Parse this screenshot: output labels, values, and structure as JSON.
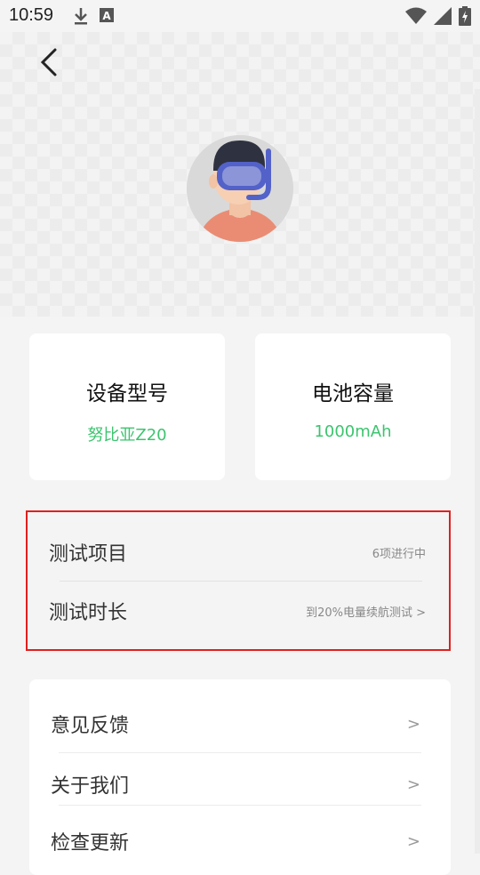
{
  "status_bar": {
    "time": "10:59",
    "icons_left": [
      "download-icon",
      "app-a-icon"
    ],
    "icons_right": [
      "wifi-icon",
      "signal-icon",
      "battery-charging-icon"
    ]
  },
  "header": {
    "back_icon": "chevron-left-icon",
    "avatar": "diver-avatar"
  },
  "cards": [
    {
      "title": "设备型号",
      "value": "努比亚Z20"
    },
    {
      "title": "电池容量",
      "value": "1000mAh"
    }
  ],
  "test_panel": {
    "rows": [
      {
        "label": "测试项目",
        "value": "6项进行中"
      },
      {
        "label": "测试时长",
        "value": "到20%电量续航测试 >"
      }
    ],
    "border_color": "#e0201e"
  },
  "menu": {
    "items": [
      {
        "label": "意见反馈",
        "arrow": ">"
      },
      {
        "label": "关于我们",
        "arrow": ">"
      },
      {
        "label": "检查更新",
        "arrow": ">"
      }
    ]
  },
  "colors": {
    "accent_green": "#3cc46e",
    "background": "#f4f4f4"
  }
}
